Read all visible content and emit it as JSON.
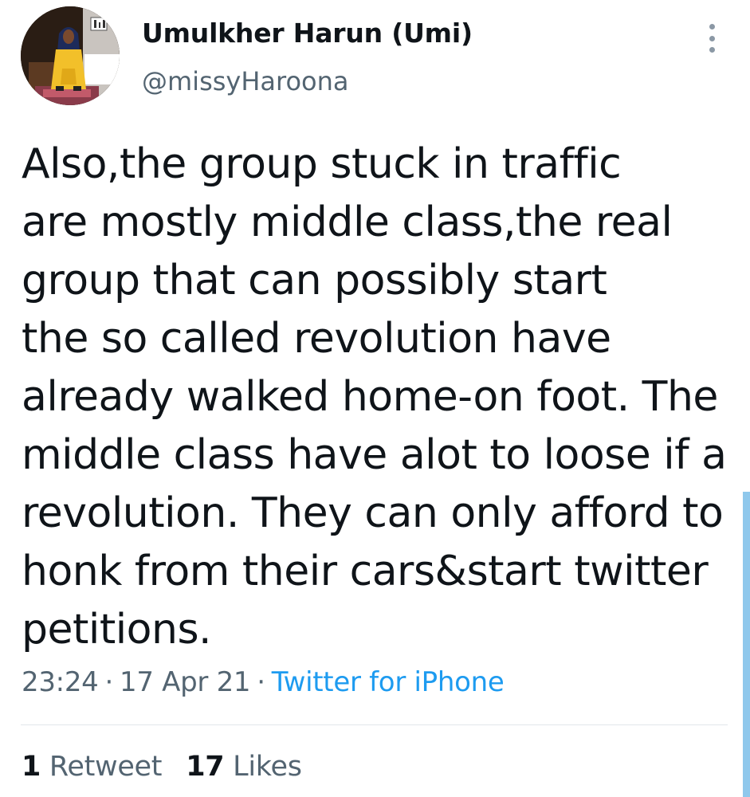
{
  "author": {
    "display_name": "Umulkher Harun (Umi)",
    "handle": "@missyHaroona",
    "avatar_icon": "profile-photo"
  },
  "tweet": {
    "lines": [
      "Also,the group stuck in traffic",
      "are mostly middle class,the real",
      "group that can possibly start",
      "the so called revolution have",
      "already walked home-on foot. The",
      "middle class have alot to loose if a",
      "revolution. They can only afford to",
      "honk from their cars&start twitter",
      "petitions."
    ]
  },
  "meta": {
    "time": "23:24",
    "separator": "·",
    "date": "17 Apr 21",
    "source": "Twitter for iPhone"
  },
  "stats": {
    "retweets_count": "1",
    "retweets_label": "Retweet",
    "likes_count": "17",
    "likes_label": "Likes"
  },
  "colors": {
    "text_primary": "#0f1419",
    "text_secondary": "#536471",
    "link": "#1d9bf0",
    "scrollbar": "#8fc8ec"
  }
}
